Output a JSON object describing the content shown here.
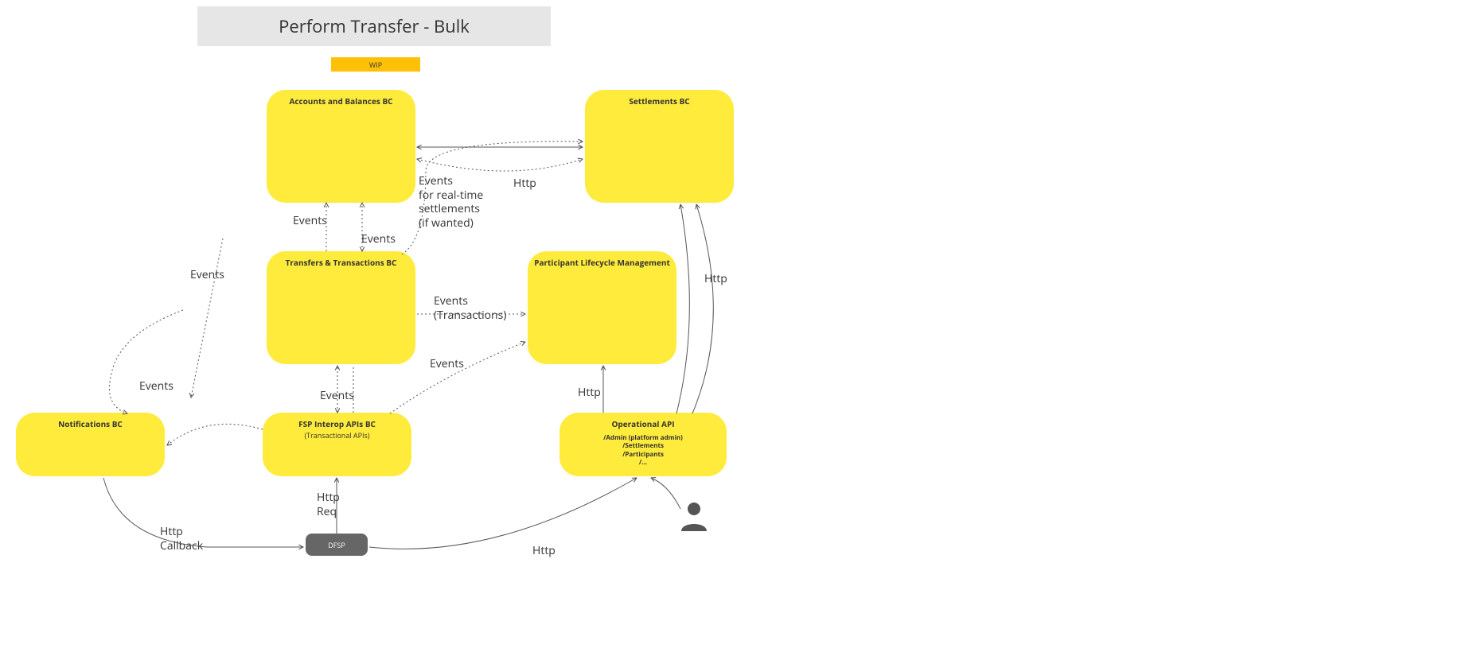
{
  "title": "Perform Transfer - Bulk",
  "badge": "WIP",
  "nodes": {
    "accounts": {
      "title": "Accounts and Balances BC"
    },
    "settlements": {
      "title": "Settlements BC"
    },
    "transfers": {
      "title": "Transfers & Transactions BC"
    },
    "participant": {
      "title": "Participant Lifecycle Management"
    },
    "notifications": {
      "title": "Notifications BC"
    },
    "fsp": {
      "title": "FSP Interop APIs BC",
      "sub": "(Transactional APIs)"
    },
    "operational": {
      "title": "Operational API",
      "line1": "/Admin (platform admin)",
      "line2": "/Settlements",
      "line3": "/Participants",
      "line4": "/..."
    },
    "dfsp": {
      "title": "DFSP"
    }
  },
  "labels": {
    "events_left": "Events",
    "events_nt": "Events",
    "events_ta": "Events",
    "events_ta2": "Events",
    "events_rt": "Events\nfor real-time\nsettlements\n(if wanted)",
    "http_as": "Http",
    "events_tx": "Events\n(Transactions)",
    "events_tp": "Events",
    "events_tf": "Events",
    "http_op_p": "Http",
    "http_op_s": "Http",
    "http_req": "Http\nReq",
    "http_cb": "Http\nCallback",
    "http_dfsp_op": "Http"
  }
}
